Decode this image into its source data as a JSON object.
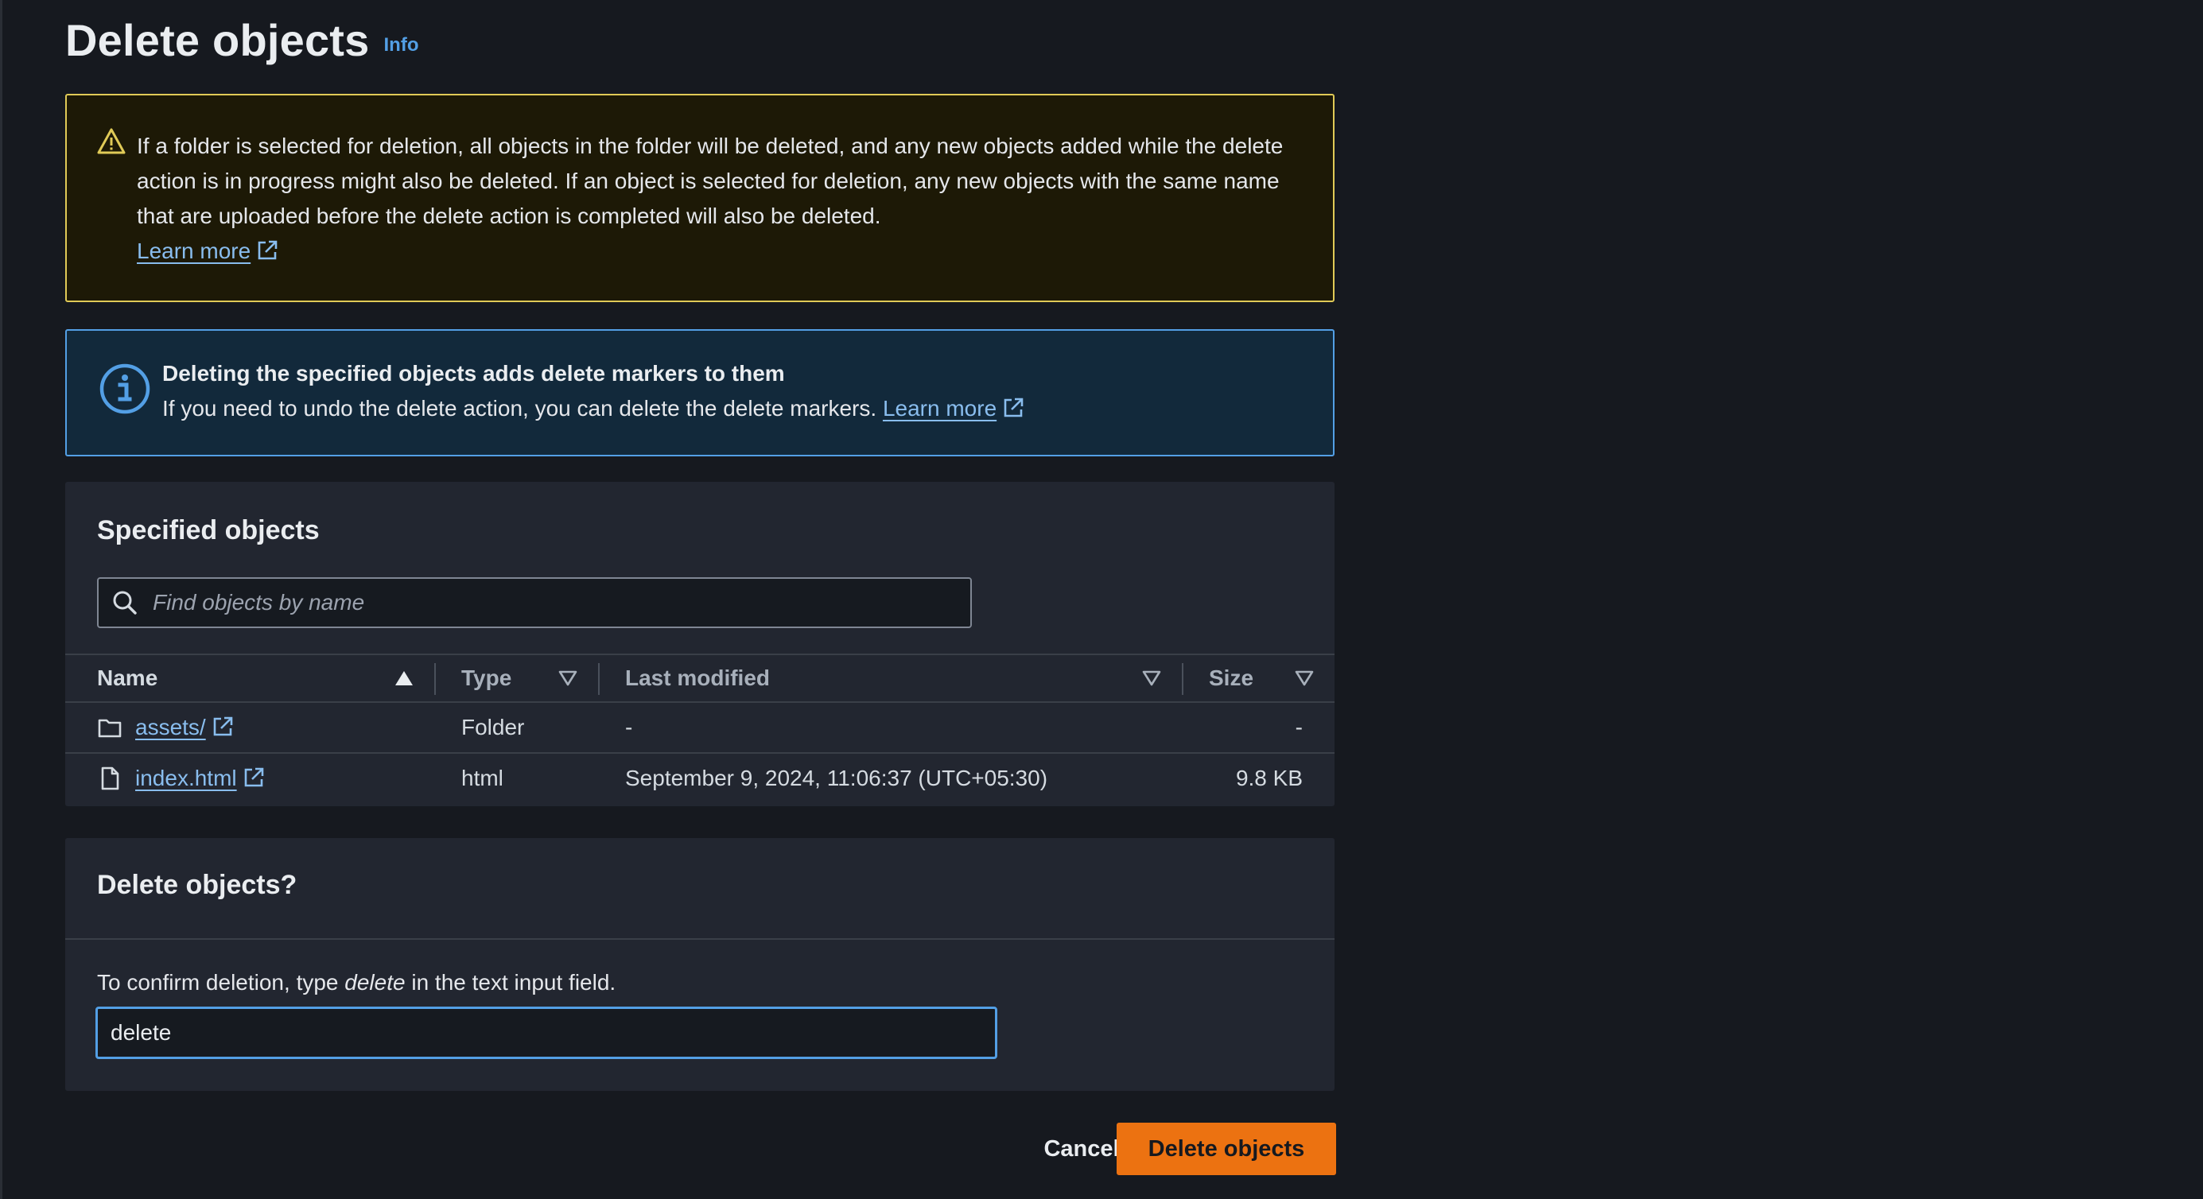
{
  "page": {
    "title": "Delete objects",
    "info_link": "Info"
  },
  "warning_alert": {
    "text": "If a folder is selected for deletion, all objects in the folder will be deleted, and any new objects added while the delete action is in progress might also be deleted. If an object is selected for deletion, any new objects with the same name that are uploaded before the delete action is completed will also be deleted.",
    "link": "Learn more",
    "icon": "warning-icon",
    "color": "#e0ca57"
  },
  "info_alert": {
    "title": "Deleting the specified objects adds delete markers to them",
    "body": "If you need to undo the delete action, you can delete the delete markers.",
    "link": "Learn more",
    "icon": "info-icon",
    "color": "#539fe5"
  },
  "specified_objects": {
    "title": "Specified objects",
    "search_placeholder": "Find objects by name",
    "columns": {
      "name": "Name",
      "type": "Type",
      "last_modified": "Last modified",
      "size": "Size"
    },
    "rows": [
      {
        "icon": "folder-icon",
        "name": "assets/",
        "type": "Folder",
        "last_modified": "-",
        "size": "-"
      },
      {
        "icon": "file-icon",
        "name": "index.html",
        "type": "html",
        "last_modified": "September 9, 2024, 11:06:37 (UTC+05:30)",
        "size": "9.8 KB"
      }
    ]
  },
  "confirm": {
    "title": "Delete objects?",
    "instruction_prefix": "To confirm deletion, type ",
    "instruction_keyword": "delete",
    "instruction_suffix": " in the text input field.",
    "input_value": "delete"
  },
  "actions": {
    "cancel": "Cancel",
    "delete": "Delete objects",
    "primary_color": "#ec7211"
  }
}
